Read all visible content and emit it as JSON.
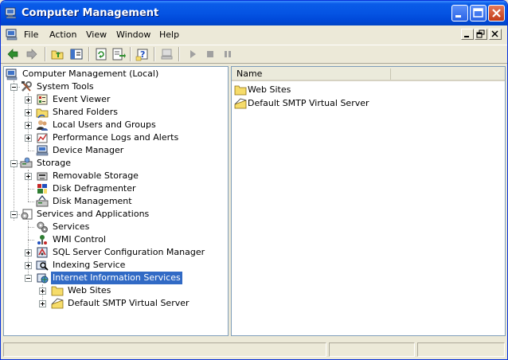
{
  "window": {
    "title": "Computer Management"
  },
  "menu": {
    "items": [
      {
        "label": "File"
      },
      {
        "label": "Action"
      },
      {
        "label": "View"
      },
      {
        "label": "Window"
      },
      {
        "label": "Help"
      }
    ]
  },
  "tree": {
    "root": "Computer Management (Local)",
    "system_tools": "System Tools",
    "event_viewer": "Event Viewer",
    "shared_folders": "Shared Folders",
    "local_users": "Local Users and Groups",
    "perf_logs": "Performance Logs and Alerts",
    "device_manager": "Device Manager",
    "storage": "Storage",
    "removable_storage": "Removable Storage",
    "disk_defrag": "Disk Defragmenter",
    "disk_mgmt": "Disk Management",
    "services_apps": "Services and Applications",
    "services": "Services",
    "wmi": "WMI Control",
    "sql": "SQL Server Configuration Manager",
    "indexing": "Indexing Service",
    "iis": "Internet Information Services",
    "web_sites": "Web Sites",
    "smtp": "Default SMTP Virtual Server"
  },
  "list": {
    "column_name": "Name",
    "items": [
      "Web Sites",
      "Default SMTP Virtual Server"
    ]
  },
  "colors": {
    "title_bar": "#0554e3",
    "selection": "#316ac5",
    "face": "#ece9d8"
  }
}
